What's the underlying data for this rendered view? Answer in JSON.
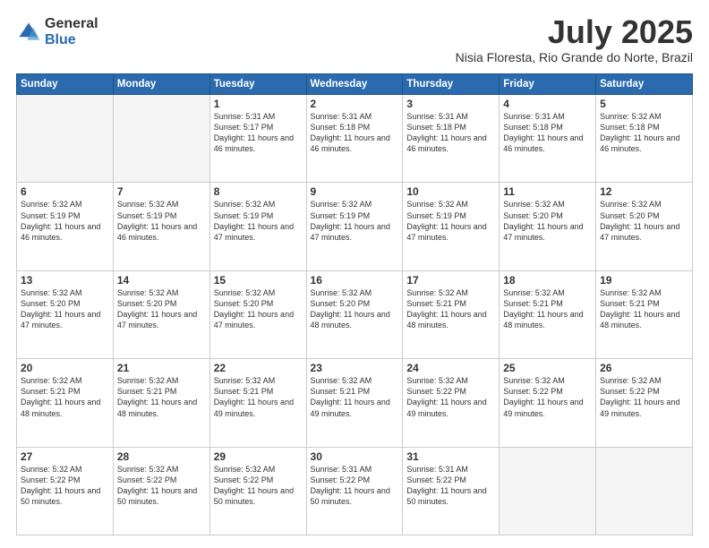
{
  "logo": {
    "general": "General",
    "blue": "Blue"
  },
  "header": {
    "month": "July 2025",
    "location": "Nisia Floresta, Rio Grande do Norte, Brazil"
  },
  "weekdays": [
    "Sunday",
    "Monday",
    "Tuesday",
    "Wednesday",
    "Thursday",
    "Friday",
    "Saturday"
  ],
  "weeks": [
    [
      {
        "day": "",
        "empty": true
      },
      {
        "day": "",
        "empty": true
      },
      {
        "day": "1",
        "sunrise": "5:31 AM",
        "sunset": "5:17 PM",
        "daylight": "11 hours and 46 minutes."
      },
      {
        "day": "2",
        "sunrise": "5:31 AM",
        "sunset": "5:18 PM",
        "daylight": "11 hours and 46 minutes."
      },
      {
        "day": "3",
        "sunrise": "5:31 AM",
        "sunset": "5:18 PM",
        "daylight": "11 hours and 46 minutes."
      },
      {
        "day": "4",
        "sunrise": "5:31 AM",
        "sunset": "5:18 PM",
        "daylight": "11 hours and 46 minutes."
      },
      {
        "day": "5",
        "sunrise": "5:32 AM",
        "sunset": "5:18 PM",
        "daylight": "11 hours and 46 minutes."
      }
    ],
    [
      {
        "day": "6",
        "sunrise": "5:32 AM",
        "sunset": "5:19 PM",
        "daylight": "11 hours and 46 minutes."
      },
      {
        "day": "7",
        "sunrise": "5:32 AM",
        "sunset": "5:19 PM",
        "daylight": "11 hours and 46 minutes."
      },
      {
        "day": "8",
        "sunrise": "5:32 AM",
        "sunset": "5:19 PM",
        "daylight": "11 hours and 47 minutes."
      },
      {
        "day": "9",
        "sunrise": "5:32 AM",
        "sunset": "5:19 PM",
        "daylight": "11 hours and 47 minutes."
      },
      {
        "day": "10",
        "sunrise": "5:32 AM",
        "sunset": "5:19 PM",
        "daylight": "11 hours and 47 minutes."
      },
      {
        "day": "11",
        "sunrise": "5:32 AM",
        "sunset": "5:20 PM",
        "daylight": "11 hours and 47 minutes."
      },
      {
        "day": "12",
        "sunrise": "5:32 AM",
        "sunset": "5:20 PM",
        "daylight": "11 hours and 47 minutes."
      }
    ],
    [
      {
        "day": "13",
        "sunrise": "5:32 AM",
        "sunset": "5:20 PM",
        "daylight": "11 hours and 47 minutes."
      },
      {
        "day": "14",
        "sunrise": "5:32 AM",
        "sunset": "5:20 PM",
        "daylight": "11 hours and 47 minutes."
      },
      {
        "day": "15",
        "sunrise": "5:32 AM",
        "sunset": "5:20 PM",
        "daylight": "11 hours and 47 minutes."
      },
      {
        "day": "16",
        "sunrise": "5:32 AM",
        "sunset": "5:20 PM",
        "daylight": "11 hours and 48 minutes."
      },
      {
        "day": "17",
        "sunrise": "5:32 AM",
        "sunset": "5:21 PM",
        "daylight": "11 hours and 48 minutes."
      },
      {
        "day": "18",
        "sunrise": "5:32 AM",
        "sunset": "5:21 PM",
        "daylight": "11 hours and 48 minutes."
      },
      {
        "day": "19",
        "sunrise": "5:32 AM",
        "sunset": "5:21 PM",
        "daylight": "11 hours and 48 minutes."
      }
    ],
    [
      {
        "day": "20",
        "sunrise": "5:32 AM",
        "sunset": "5:21 PM",
        "daylight": "11 hours and 48 minutes."
      },
      {
        "day": "21",
        "sunrise": "5:32 AM",
        "sunset": "5:21 PM",
        "daylight": "11 hours and 48 minutes."
      },
      {
        "day": "22",
        "sunrise": "5:32 AM",
        "sunset": "5:21 PM",
        "daylight": "11 hours and 49 minutes."
      },
      {
        "day": "23",
        "sunrise": "5:32 AM",
        "sunset": "5:21 PM",
        "daylight": "11 hours and 49 minutes."
      },
      {
        "day": "24",
        "sunrise": "5:32 AM",
        "sunset": "5:22 PM",
        "daylight": "11 hours and 49 minutes."
      },
      {
        "day": "25",
        "sunrise": "5:32 AM",
        "sunset": "5:22 PM",
        "daylight": "11 hours and 49 minutes."
      },
      {
        "day": "26",
        "sunrise": "5:32 AM",
        "sunset": "5:22 PM",
        "daylight": "11 hours and 49 minutes."
      }
    ],
    [
      {
        "day": "27",
        "sunrise": "5:32 AM",
        "sunset": "5:22 PM",
        "daylight": "11 hours and 50 minutes."
      },
      {
        "day": "28",
        "sunrise": "5:32 AM",
        "sunset": "5:22 PM",
        "daylight": "11 hours and 50 minutes."
      },
      {
        "day": "29",
        "sunrise": "5:32 AM",
        "sunset": "5:22 PM",
        "daylight": "11 hours and 50 minutes."
      },
      {
        "day": "30",
        "sunrise": "5:31 AM",
        "sunset": "5:22 PM",
        "daylight": "11 hours and 50 minutes."
      },
      {
        "day": "31",
        "sunrise": "5:31 AM",
        "sunset": "5:22 PM",
        "daylight": "11 hours and 50 minutes."
      },
      {
        "day": "",
        "empty": true
      },
      {
        "day": "",
        "empty": true
      }
    ]
  ],
  "labels": {
    "sunrise_prefix": "Sunrise: ",
    "sunset_prefix": "Sunset: ",
    "daylight_prefix": "Daylight: "
  }
}
